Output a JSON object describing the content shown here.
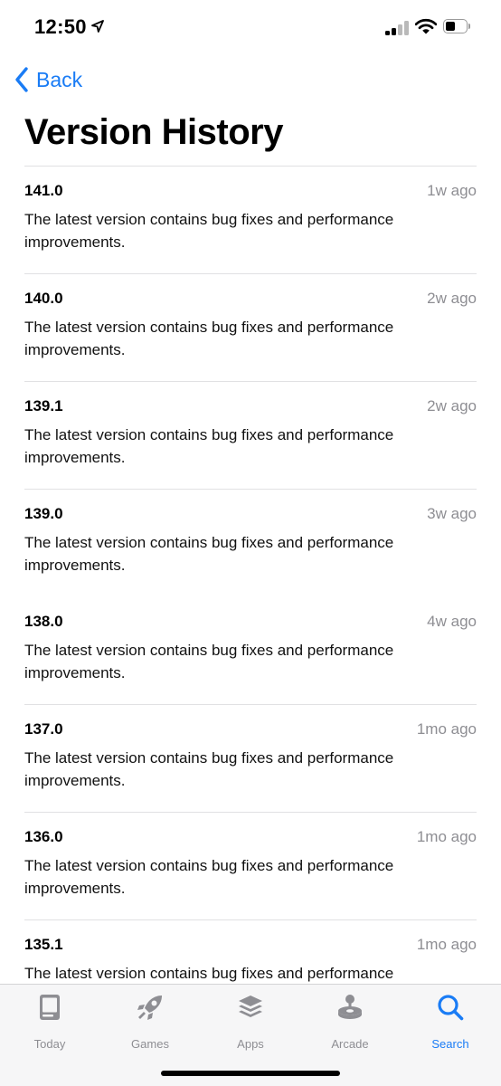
{
  "status_bar": {
    "time": "12:50"
  },
  "nav": {
    "back_label": "Back",
    "title": "Version History"
  },
  "versions": [
    {
      "number": "141.0",
      "date": "1w ago",
      "notes": "The latest version contains bug fixes and performance improvements."
    },
    {
      "number": "140.0",
      "date": "2w ago",
      "notes": "The latest version contains bug fixes and performance improvements."
    },
    {
      "number": "139.1",
      "date": "2w ago",
      "notes": "The latest version contains bug fixes and performance improvements."
    },
    {
      "number": "139.0",
      "date": "3w ago",
      "notes": "The latest version contains bug fixes and performance improvements."
    },
    {
      "number": "138.0",
      "date": "4w ago",
      "notes": "The latest version contains bug fixes and performance improvements."
    },
    {
      "number": "137.0",
      "date": "1mo ago",
      "notes": "The latest version contains bug fixes and performance improvements."
    },
    {
      "number": "136.0",
      "date": "1mo ago",
      "notes": "The latest version contains bug fixes and performance improvements."
    },
    {
      "number": "135.1",
      "date": "1mo ago",
      "notes": "The latest version contains bug fixes and performance"
    }
  ],
  "tab_bar": {
    "active": "search",
    "tabs": [
      {
        "id": "today",
        "label": "Today",
        "icon": "today-icon"
      },
      {
        "id": "games",
        "label": "Games",
        "icon": "rocket-icon"
      },
      {
        "id": "apps",
        "label": "Apps",
        "icon": "layers-icon"
      },
      {
        "id": "arcade",
        "label": "Arcade",
        "icon": "joystick-icon"
      },
      {
        "id": "search",
        "label": "Search",
        "icon": "search-icon"
      }
    ]
  },
  "colors": {
    "accent": "#1a7cf5",
    "secondary_text": "#8e8e93",
    "divider": "#e1e1e3",
    "tab_bar_bg": "#f6f6f7"
  }
}
